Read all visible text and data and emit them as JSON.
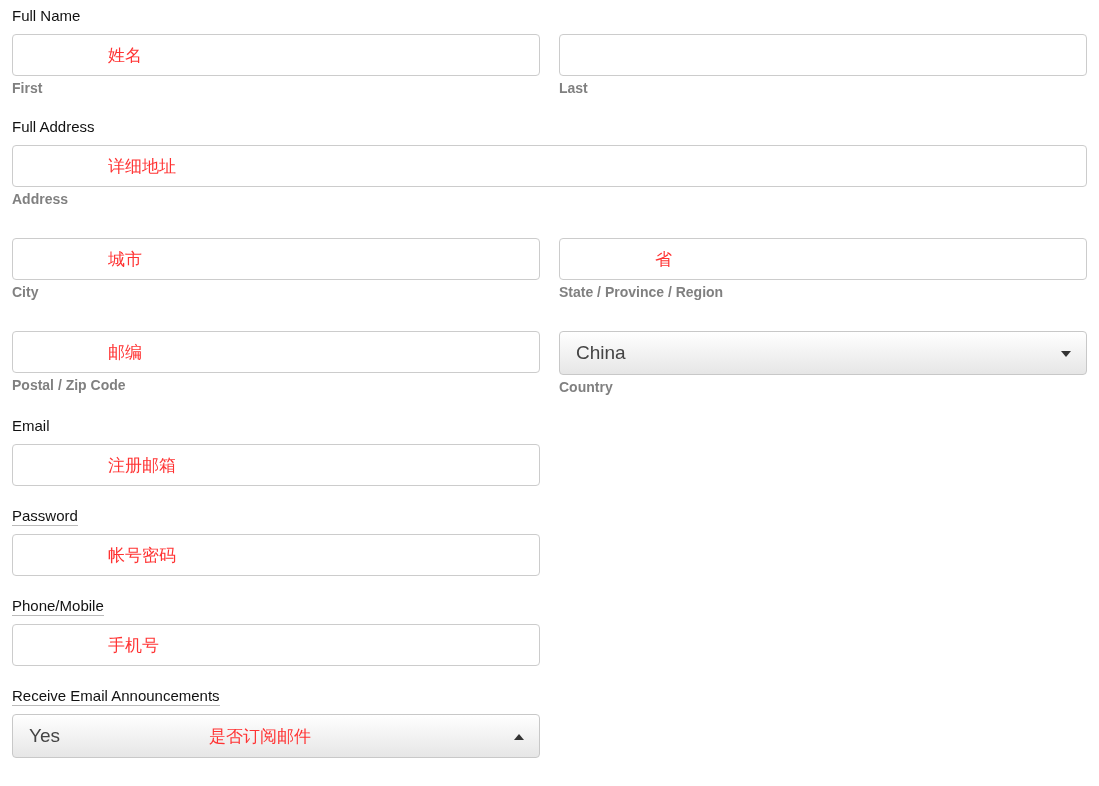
{
  "sections": [
    {
      "label": "Full Name",
      "underlined": false,
      "rows": [
        [
          {
            "kind": "text",
            "note": "姓名",
            "sublabel": "First"
          },
          {
            "kind": "text",
            "sublabel": "Last"
          }
        ]
      ]
    },
    {
      "label": "Full Address",
      "underlined": false,
      "rows": [
        [
          {
            "kind": "text",
            "note": "详细地址",
            "sublabel": "Address"
          }
        ],
        [
          {
            "kind": "text",
            "note": "城市",
            "sublabel": "City"
          },
          {
            "kind": "text",
            "note": "省",
            "sublabel": "State / Province / Region"
          }
        ],
        [
          {
            "kind": "text",
            "note": "邮编",
            "sublabel": "Postal / Zip Code"
          },
          {
            "kind": "select",
            "value": "China",
            "expanded": false,
            "sublabel": "Country"
          }
        ]
      ]
    },
    {
      "label": "Email",
      "underlined": false,
      "rows": [
        [
          {
            "kind": "text",
            "note": "注册邮箱"
          },
          {
            "kind": "empty"
          }
        ]
      ]
    },
    {
      "label": "Password",
      "underlined": true,
      "rows": [
        [
          {
            "kind": "text",
            "note": "帐号密码"
          },
          {
            "kind": "empty"
          }
        ]
      ]
    },
    {
      "label": "Phone/Mobile",
      "underlined": true,
      "rows": [
        [
          {
            "kind": "text",
            "note": "手机号"
          },
          {
            "kind": "empty"
          }
        ]
      ]
    },
    {
      "label": "Receive Email Announcements",
      "underlined": true,
      "rows": [
        [
          {
            "kind": "select",
            "value": "Yes",
            "expanded": true,
            "note": "是否订阅邮件"
          },
          {
            "kind": "empty"
          }
        ]
      ]
    }
  ]
}
